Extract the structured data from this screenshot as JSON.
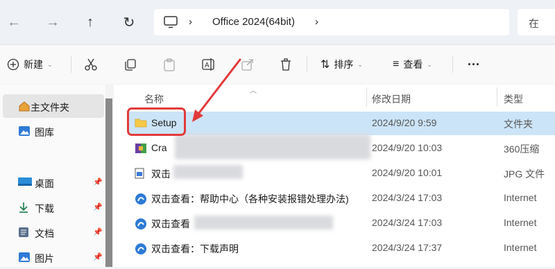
{
  "nav": {
    "back": "←",
    "forward": "→",
    "up": "↑",
    "refresh": "↻"
  },
  "address": {
    "separator": "›",
    "folder": "Office 2024(64bit)",
    "trailing": "›"
  },
  "search": {
    "label": "在"
  },
  "toolbar": {
    "new_label": "新建",
    "sort_label": "排序",
    "view_label": "查看",
    "more_label": "···"
  },
  "sidebar": {
    "items": [
      {
        "label": "主文件夹",
        "icon": "home-icon"
      },
      {
        "label": "图库",
        "icon": "gallery-icon"
      },
      {
        "label": "桌面",
        "icon": "desktop-icon"
      },
      {
        "label": "下载",
        "icon": "download-icon"
      },
      {
        "label": "文档",
        "icon": "document-icon"
      },
      {
        "label": "图片",
        "icon": "pictures-icon"
      }
    ]
  },
  "columns": {
    "name": "名称",
    "modified": "修改日期",
    "type": "类型"
  },
  "files": [
    {
      "name": "Setup",
      "date": "2024/9/20 9:59",
      "type": "文件夹",
      "icon": "folder-icon"
    },
    {
      "name": "Cra",
      "date": "2024/9/20 10:03",
      "type": "360压缩",
      "icon": "archive-icon"
    },
    {
      "name": "双击",
      "date": "2024/9/20 10:01",
      "type": "JPG 文件",
      "icon": "image-file-icon"
    },
    {
      "name": "双击查看：帮助中心（各种安装报错处理办法)",
      "date": "2024/3/24 17:03",
      "type": "Internet",
      "icon": "internet-shortcut-icon"
    },
    {
      "name": "双击查看",
      "date": "2024/3/24 17:03",
      "type": "Internet",
      "icon": "internet-shortcut-icon"
    },
    {
      "name": "双击查看：下载声明",
      "date": "2024/3/24 17:37",
      "type": "Internet",
      "icon": "internet-shortcut-icon"
    }
  ],
  "colors": {
    "selection": "#cce4f7",
    "highlight": "#e23a3a",
    "folder": "#f7c948"
  }
}
